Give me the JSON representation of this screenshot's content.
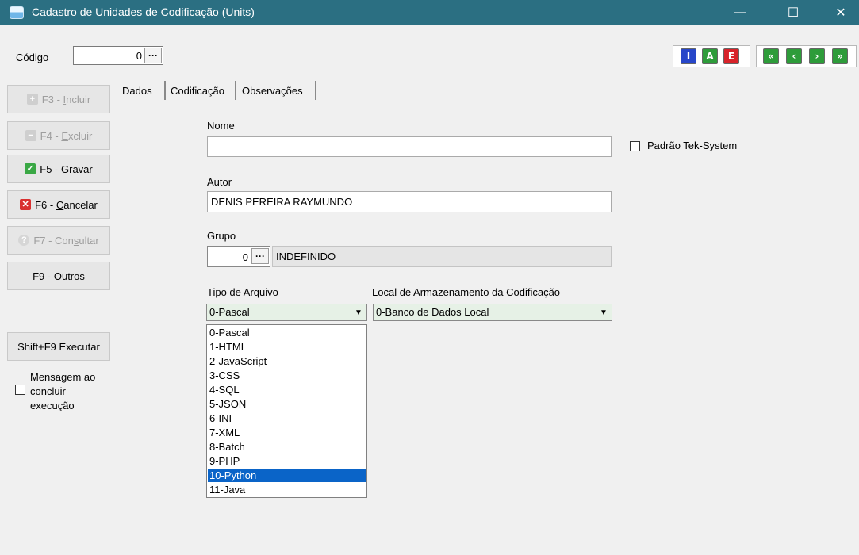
{
  "window": {
    "title": "Cadastro de Unidades de Codificação (Units)",
    "controls": {
      "minimize": "—",
      "maximize": "☐",
      "close": "✕"
    }
  },
  "toolbar": {
    "codigo_label": "Código",
    "codigo_value": "0",
    "ellipsis": "···",
    "record_buttons": [
      {
        "label": "I",
        "color": "#2746c9",
        "icon": "insert-icon"
      },
      {
        "label": "A",
        "color": "#2e9c3a",
        "icon": "alter-icon"
      },
      {
        "label": "E",
        "color": "#d8232a",
        "icon": "delete-icon"
      }
    ],
    "nav_buttons": [
      {
        "label": "«",
        "icon": "first-record-icon"
      },
      {
        "label": "‹",
        "icon": "previous-record-icon"
      },
      {
        "label": "›",
        "icon": "next-record-icon"
      },
      {
        "label": "»",
        "icon": "last-record-icon"
      }
    ],
    "nav_color": "#2e9c3a"
  },
  "sidebar": {
    "buttons": [
      {
        "pre": "F3 - ",
        "u": "I",
        "post": "ncluir",
        "enabled": false,
        "icon": "plus-icon"
      },
      {
        "pre": "F4 - ",
        "u": "E",
        "post": "xcluir",
        "enabled": false,
        "icon": "minus-icon"
      },
      {
        "pre": "F5 - ",
        "u": "G",
        "post": "ravar",
        "enabled": true,
        "icon": "check-icon"
      },
      {
        "pre": "F6 - ",
        "u": "C",
        "post": "ancelar",
        "enabled": true,
        "icon": "x-icon"
      },
      {
        "pre": "F7 - Con",
        "u": "s",
        "post": "ultar",
        "enabled": false,
        "icon": "question-icon"
      },
      {
        "pre": "F9 - ",
        "u": "O",
        "post": "utros",
        "enabled": true,
        "icon": ""
      }
    ],
    "executar_label": "Shift+F9 Executar",
    "mensagem_checkbox": {
      "lines": [
        "Mensagem ao",
        "concluir",
        "execução"
      ],
      "checked": false
    }
  },
  "tabs": [
    {
      "label": "Dados",
      "active": true
    },
    {
      "label": "Codificação",
      "active": false
    },
    {
      "label": "Observações",
      "active": false
    }
  ],
  "form": {
    "nome": {
      "label": "Nome",
      "value": ""
    },
    "padrao": {
      "label": "Padrão Tek-System",
      "checked": false
    },
    "autor": {
      "label": "Autor",
      "value": "DENIS PEREIRA RAYMUNDO"
    },
    "grupo": {
      "label": "Grupo",
      "code": "0",
      "description": "INDEFINIDO"
    },
    "tipo_arquivo": {
      "label": "Tipo de Arquivo",
      "value": "0-Pascal",
      "options": [
        "0-Pascal",
        "1-HTML",
        "2-JavaScript",
        "3-CSS",
        "4-SQL",
        "5-JSON",
        "6-INI",
        "7-XML",
        "8-Batch",
        "9-PHP",
        "10-Python",
        "11-Java"
      ],
      "highlighted": "10-Python"
    },
    "local": {
      "label": "Local de Armazenamento da Codificação",
      "value": "0-Banco de Dados Local"
    }
  },
  "colors": {
    "titlebar": "#2b6f82",
    "combo_bg": "#e6f1e6",
    "grupo_desc_bg": "#e5e5e5",
    "selection": "#0a64c8"
  }
}
